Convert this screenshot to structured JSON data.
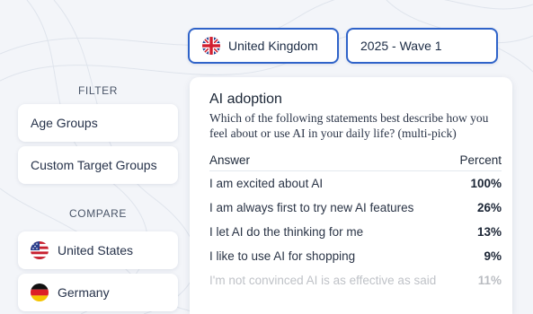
{
  "selectors": {
    "country": {
      "label": "United Kingdom",
      "flag": "uk-flag-icon"
    },
    "wave": {
      "label": "2025 - Wave 1"
    }
  },
  "sidebar": {
    "filter_title": "FILTER",
    "filter_items": [
      {
        "label": "Age Groups"
      },
      {
        "label": "Custom Target Groups"
      }
    ],
    "compare_title": "COMPARE",
    "compare_items": [
      {
        "label": "United States",
        "flag": "us-flag-icon"
      },
      {
        "label": "Germany",
        "flag": "de-flag-icon"
      }
    ]
  },
  "card": {
    "title": "AI adoption",
    "question": "Which of the following statements best describe how you feel about or use AI in your daily life? (multi-pick)",
    "columns": {
      "answer": "Answer",
      "percent": "Percent"
    },
    "rows": [
      {
        "answer": "I am excited about AI",
        "percent": "100%"
      },
      {
        "answer": "I am always first to try new AI features",
        "percent": "26%"
      },
      {
        "answer": "I let AI do the thinking for me",
        "percent": "13%"
      },
      {
        "answer": "I like to use AI for shopping",
        "percent": "9%"
      },
      {
        "answer": "I'm not convinced AI is as effective as said",
        "percent": "11%"
      }
    ]
  },
  "colors": {
    "accent": "#2f63c9",
    "background": "#f3f5f9",
    "card": "#ffffff"
  }
}
